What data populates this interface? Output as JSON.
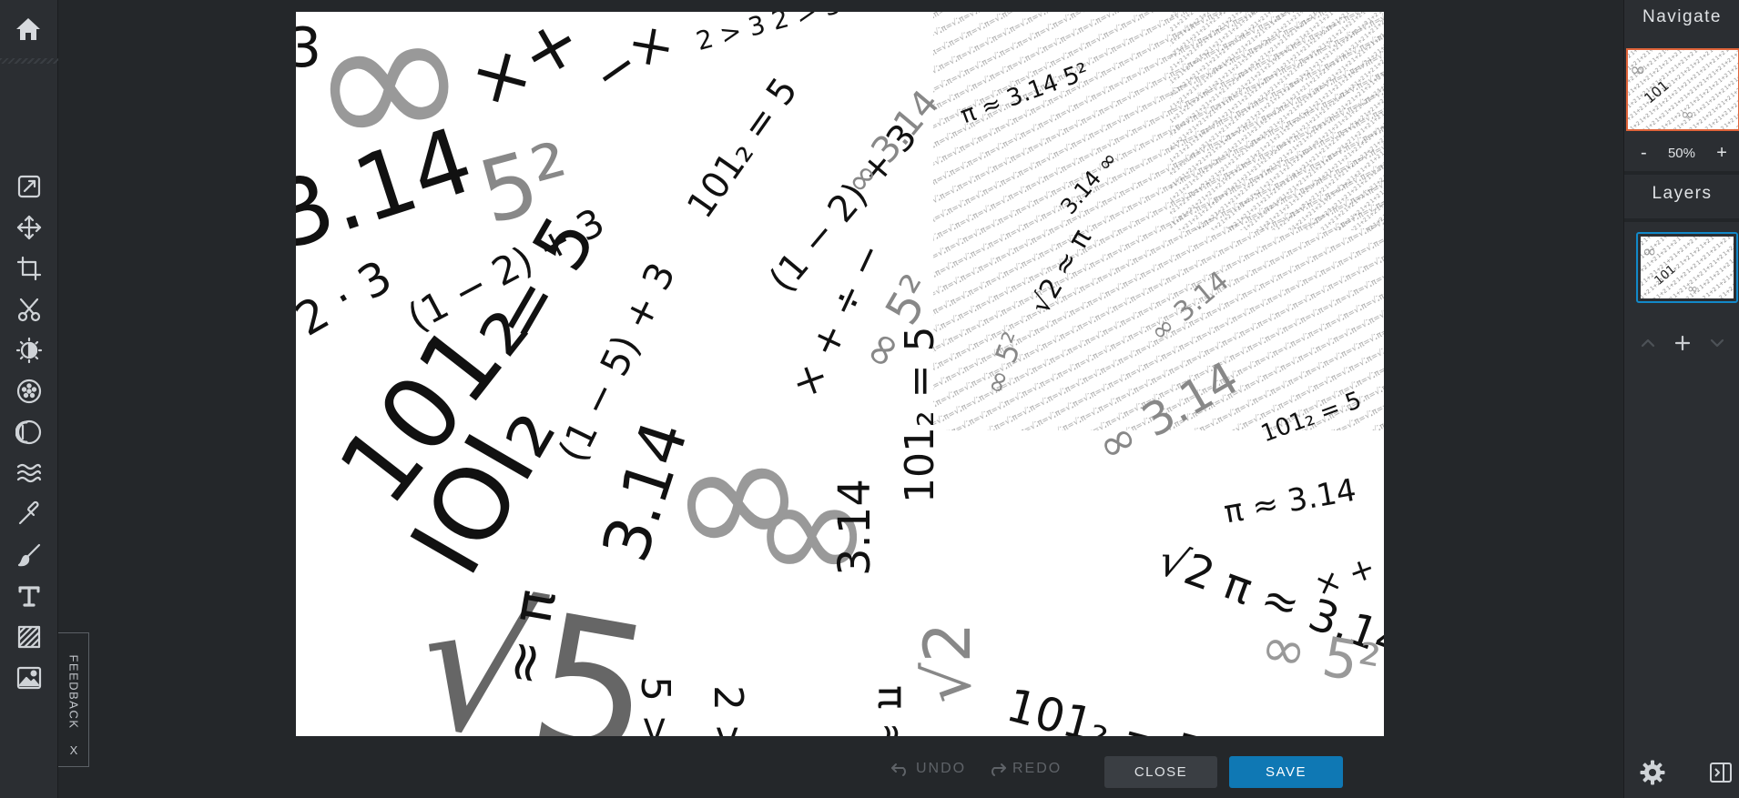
{
  "toolbar": {
    "home_icon": "home-icon",
    "tools": [
      {
        "name": "edit-tool",
        "icon": "edit-icon"
      },
      {
        "name": "move-tool",
        "icon": "move-icon"
      },
      {
        "name": "crop-tool",
        "icon": "crop-icon"
      },
      {
        "name": "cut-tool",
        "icon": "scissors-icon"
      },
      {
        "name": "brightness-tool",
        "icon": "brightness-icon"
      },
      {
        "name": "filter-tool",
        "icon": "filter-icon"
      },
      {
        "name": "vignette-tool",
        "icon": "vignette-icon"
      },
      {
        "name": "wave-tool",
        "icon": "wave-icon"
      },
      {
        "name": "eyedropper-tool",
        "icon": "eyedropper-icon"
      },
      {
        "name": "brush-tool",
        "icon": "brush-icon"
      },
      {
        "name": "text-tool",
        "icon": "text-icon"
      },
      {
        "name": "pattern-tool",
        "icon": "pattern-icon"
      },
      {
        "name": "image-tool",
        "icon": "image-icon"
      }
    ]
  },
  "feedback": {
    "label": "FEEDBACK",
    "close": "X"
  },
  "history": {
    "undo_label": "UNDO",
    "redo_label": "REDO"
  },
  "actions": {
    "close_label": "CLOSE",
    "save_label": "SAVE"
  },
  "navigate": {
    "title": "Navigate",
    "zoom_minus": "-",
    "zoom_value": "50%",
    "zoom_plus": "+"
  },
  "layers": {
    "title": "Layers"
  },
  "colors": {
    "accent": "#0f78b4",
    "layer_border": "#1289c9",
    "nav_border": "#e0643a",
    "panel_bg": "#2b2e32",
    "app_bg": "#24272a"
  }
}
